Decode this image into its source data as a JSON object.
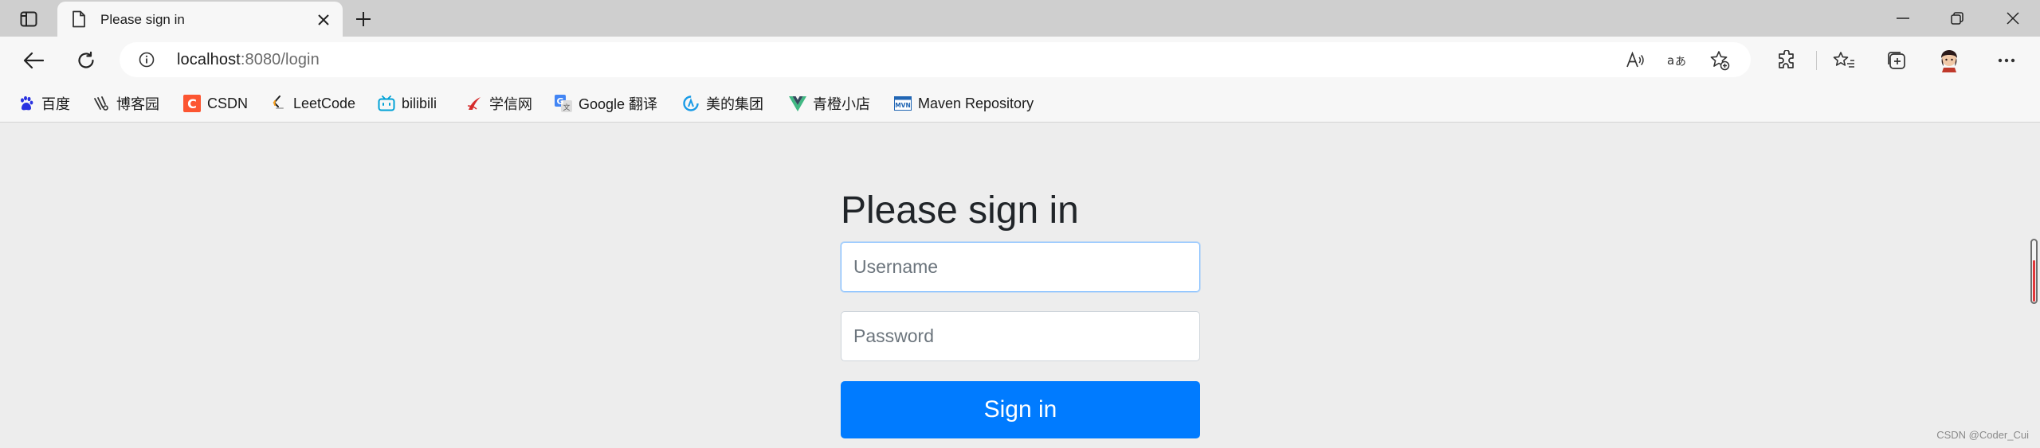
{
  "tab": {
    "title": "Please sign in"
  },
  "address_bar": {
    "host": "localhost",
    "path": ":8080/login"
  },
  "bookmarks": [
    {
      "label": "百度",
      "icon": "baidu-paw-icon"
    },
    {
      "label": "博客园",
      "icon": "cnblogs-icon"
    },
    {
      "label": "CSDN",
      "icon": "csdn-icon"
    },
    {
      "label": "LeetCode",
      "icon": "leetcode-icon"
    },
    {
      "label": "bilibili",
      "icon": "bilibili-tv-icon"
    },
    {
      "label": "学信网",
      "icon": "chsi-icon"
    },
    {
      "label": "Google 翻译",
      "icon": "google-translate-icon"
    },
    {
      "label": "美的集团",
      "icon": "midea-icon"
    },
    {
      "label": "青橙小店",
      "icon": "vue-icon"
    },
    {
      "label": "Maven Repository",
      "icon": "maven-icon"
    }
  ],
  "form": {
    "heading": "Please sign in",
    "username_placeholder": "Username",
    "password_placeholder": "Password",
    "submit_label": "Sign in"
  },
  "watermark": "CSDN @Coder_Cui",
  "colors": {
    "primary": "#007bff",
    "page_bg": "#ededed",
    "chrome_bg": "#f7f7f7",
    "tabstrip_bg": "#cfcfcf"
  }
}
